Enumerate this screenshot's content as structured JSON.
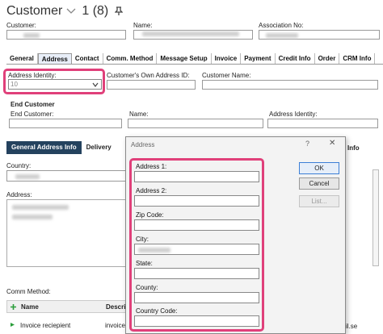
{
  "header": {
    "title": "Customer",
    "count": "1 (8)"
  },
  "top_fields": {
    "customer_label": "Customer:",
    "name_label": "Name:",
    "association_label": "Association No:"
  },
  "tabs": [
    "General",
    "Address",
    "Contact",
    "Comm. Method",
    "Message Setup",
    "Invoice",
    "Payment",
    "Credit Info",
    "Order",
    "CRM Info"
  ],
  "address": {
    "identity_label": "Address Identity:",
    "identity_value": "10",
    "own_id_label": "Customer's Own Address ID:",
    "customer_name_label": "Customer Name:"
  },
  "end_customer": {
    "title": "End Customer",
    "end_customer_label": "End Customer:",
    "name_label": "Name:",
    "address_identity_label": "Address Identity:"
  },
  "subtabs": [
    "General Address Info",
    "Delivery"
  ],
  "behind_tab": "Info",
  "left": {
    "country_label": "Country:",
    "address_label": "Address:",
    "comm_method_label": "Comm Method:",
    "grid_col_name": "Name",
    "grid_col_desc": "Descrip",
    "row_name": "Invoice reciepient",
    "row_desc": "invoice",
    "row_tail": "il.se"
  },
  "dialog": {
    "title": "Address",
    "help": "?",
    "close": "✕",
    "labels": [
      "Address 1:",
      "Address 2:",
      "Zip Code:",
      "City:",
      "State:",
      "County:",
      "Country Code:"
    ],
    "ok": "OK",
    "cancel": "Cancel",
    "list": "List..."
  },
  "colors": {
    "highlight": "#e0407a",
    "active_subtab": "#24425e"
  },
  "icons": [
    "chevron-down-icon",
    "pin-icon",
    "dropdown-arrow-icon",
    "add-icon",
    "row-arrow-icon"
  ]
}
